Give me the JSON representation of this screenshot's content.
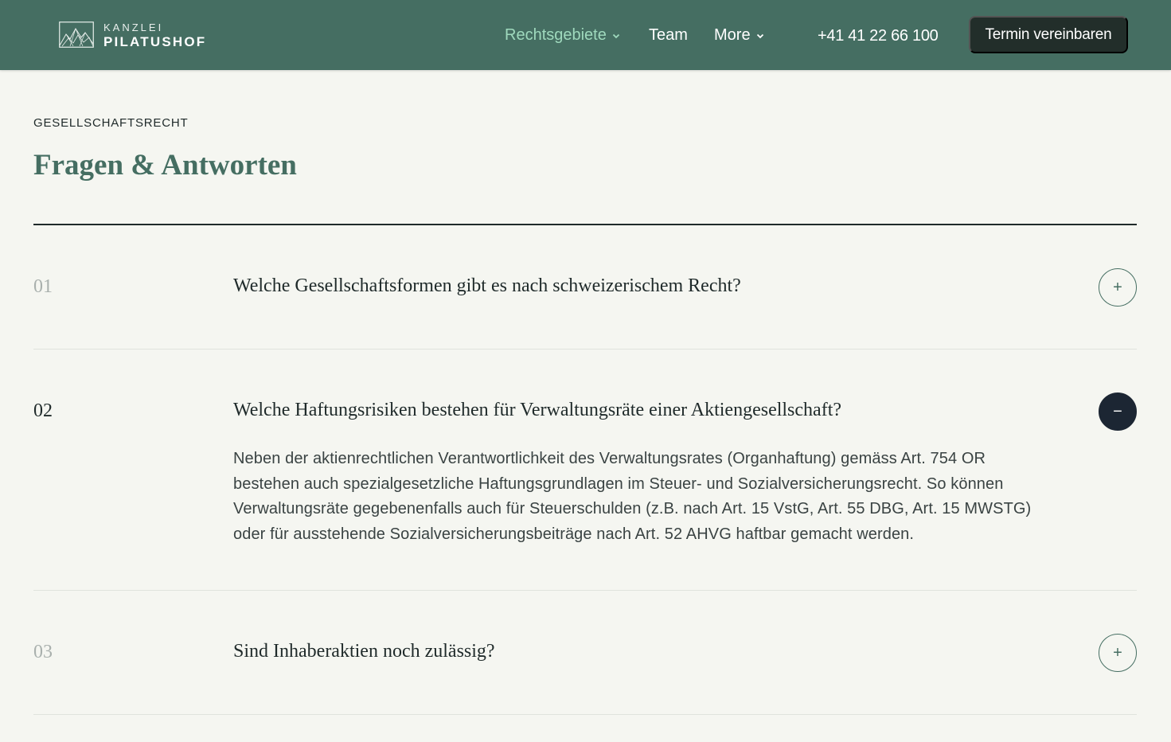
{
  "header": {
    "logo": {
      "line1": "KANZLEI",
      "line2": "PILATUSHOF"
    },
    "nav": [
      {
        "label": "Rechtsgebiete",
        "has_dropdown": true,
        "active": true
      },
      {
        "label": "Team",
        "has_dropdown": false,
        "active": false
      },
      {
        "label": "More",
        "has_dropdown": true,
        "active": false
      }
    ],
    "phone": "+41 41 22 66 100",
    "cta_label": "Termin vereinbaren"
  },
  "section": {
    "eyebrow": "GESELLSCHAFTSRECHT",
    "title": "Fragen & Antworten"
  },
  "faq": [
    {
      "number": "01",
      "question": "Welche Gesellschaftsformen gibt es nach schweizerischem Recht?",
      "open": false,
      "toggle_icon": "+"
    },
    {
      "number": "02",
      "question": "Welche Haftungsrisiken bestehen für Verwaltungsräte einer Aktiengesellschaft?",
      "open": true,
      "toggle_icon": "−",
      "answer": "Neben der aktienrechtlichen Verantwortlichkeit des Verwaltungsrates (Organhaftung) gemäss Art. 754 OR bestehen auch spezialgesetzliche Haftungsgrundlagen im Steuer- und Sozialversicherungsrecht. So können Verwaltungsräte gegebenenfalls auch für Steuerschulden (z.B. nach Art. 15 VstG, Art. 55 DBG, Art. 15 MWSTG) oder für ausstehende Sozialversicherungsbeiträge nach Art. 52 AHVG haftbar gemacht werden."
    },
    {
      "number": "03",
      "question": "Sind Inhaberaktien noch zulässig?",
      "open": false,
      "toggle_icon": "+"
    }
  ],
  "colors": {
    "header_bg": "#456e62",
    "accent_nav": "#9fd9bd",
    "cta_bg": "#222e2a",
    "title": "#456e62",
    "open_toggle_bg": "#1c2633",
    "page_bg": "#f5f6f1"
  }
}
